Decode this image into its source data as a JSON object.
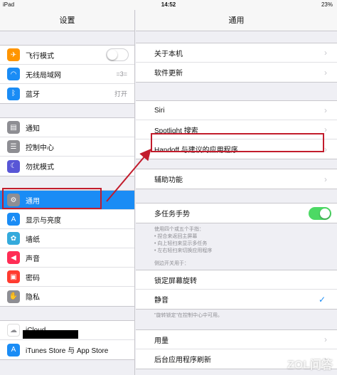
{
  "status_bar": {
    "device": "iPad",
    "time": "14:52",
    "battery": "23%"
  },
  "sidebar": {
    "title": "设置",
    "groups": [
      [
        {
          "label": "飞行模式",
          "icon": "airplane-icon",
          "color": "#ff9500",
          "toggle": "off"
        },
        {
          "label": "无线局域网",
          "icon": "wifi-icon",
          "color": "#1a8cf5",
          "value": "=3="
        },
        {
          "label": "蓝牙",
          "icon": "bluetooth-icon",
          "color": "#1a8cf5",
          "value": "打开"
        }
      ],
      [
        {
          "label": "通知",
          "icon": "notifications-icon",
          "color": "#8e8e93"
        },
        {
          "label": "控制中心",
          "icon": "control-center-icon",
          "color": "#8e8e93"
        },
        {
          "label": "勿扰模式",
          "icon": "moon-icon",
          "color": "#5856d6"
        }
      ],
      [
        {
          "label": "通用",
          "icon": "gear-icon",
          "color": "#8e8e93",
          "selected": true
        },
        {
          "label": "显示与亮度",
          "icon": "brightness-icon",
          "color": "#1a8cf5"
        },
        {
          "label": "墙纸",
          "icon": "wallpaper-icon",
          "color": "#34aadc"
        },
        {
          "label": "声音",
          "icon": "sound-icon",
          "color": "#ff2d55"
        },
        {
          "label": "密码",
          "icon": "lock-icon",
          "color": "#ff3b30"
        },
        {
          "label": "隐私",
          "icon": "hand-icon",
          "color": "#8e8e93"
        }
      ],
      [
        {
          "label": "iCloud",
          "icon": "cloud-icon",
          "color": "#ffffff"
        },
        {
          "label": "iTunes Store 与 App Store",
          "icon": "appstore-icon",
          "color": "#1a8cf5"
        }
      ]
    ]
  },
  "detail": {
    "title": "通用",
    "group1": [
      "关于本机",
      "软件更新"
    ],
    "group2": [
      "Siri",
      "Spotlight 搜索",
      "Handoff 与建议的应用程序"
    ],
    "group3": [
      "辅助功能"
    ],
    "multitask": {
      "label": "多任务手势",
      "toggle": "on"
    },
    "multitask_notes": [
      "使用四个或五个手指：",
      "• 捏合来返回主屏幕",
      "• 向上轻扫来显示多任务",
      "• 左右轻扫来切换应用程序"
    ],
    "side_switch_header": "侧边开关用于：",
    "side_switch": [
      {
        "label": "锁定屏幕旋转",
        "checked": false
      },
      {
        "label": "静音",
        "checked": true
      }
    ],
    "side_switch_note": "\"旋转锁定\"在控制中心中可用。",
    "group5": [
      "用量",
      "后台应用程序刷新"
    ]
  },
  "watermark": "ZOL问答"
}
